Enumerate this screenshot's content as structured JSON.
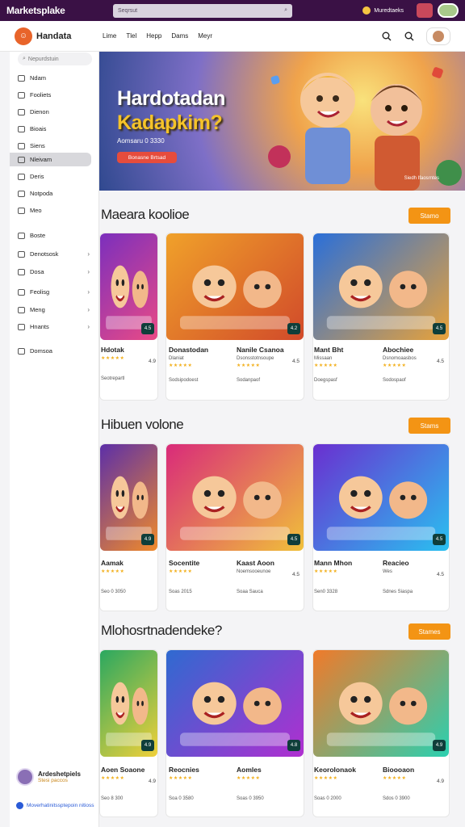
{
  "topbar": {
    "brand": "Marketsplake",
    "search_placeholder": "Seqrsut",
    "user_status": "Muredtaeks"
  },
  "header": {
    "logo_glyph": "☺",
    "app_name": "Handata",
    "nav": [
      "Lime",
      "Tlel",
      "Hepp",
      "Dams",
      "Meyr"
    ]
  },
  "sidebar": {
    "search_placeholder": "Nepurdstuin",
    "items": [
      {
        "label": "Ndam",
        "chevron": false,
        "active": false
      },
      {
        "label": "Fooliets",
        "chevron": false,
        "active": false
      },
      {
        "label": "Dienon",
        "chevron": false,
        "active": false
      },
      {
        "label": "Bioais",
        "chevron": false,
        "active": false
      },
      {
        "label": "Siens",
        "chevron": false,
        "active": false
      },
      {
        "label": "Nleivam",
        "chevron": false,
        "active": true
      },
      {
        "label": "Deris",
        "chevron": false,
        "active": false
      },
      {
        "label": "Notpoda",
        "chevron": false,
        "active": false
      },
      {
        "label": "Meo",
        "chevron": false,
        "active": false
      },
      {
        "label": "Boste",
        "chevron": false,
        "active": false
      },
      {
        "label": "Denotsosk",
        "chevron": true,
        "active": false
      },
      {
        "label": "Dosa",
        "chevron": true,
        "active": false
      },
      {
        "label": "Feolisg",
        "chevron": true,
        "active": false
      },
      {
        "label": "Meng",
        "chevron": true,
        "active": false
      },
      {
        "label": "Hnants",
        "chevron": true,
        "active": false
      },
      {
        "label": "Domsoa",
        "chevron": false,
        "active": false
      }
    ],
    "user_name": "Ardeshetpiels",
    "user_status": "Stesi paccos",
    "footer_link": "Moverhatinitssptepoin nitioss"
  },
  "hero": {
    "title_line1": "Hardotadan",
    "title_line2": "Kadapkim?",
    "meta": "Aomsaru 0 3330",
    "cta": "Bonasne Brtsad",
    "tag": "Siedh Ifaosrntes"
  },
  "sections": [
    {
      "title": "Maeara koolioe",
      "button": "Stamo",
      "cards": [
        {
          "title": "Hdotak",
          "sub1": "",
          "rating": "★★★★★",
          "score": "4.9",
          "footer": "Seotrepartl",
          "badge": "4.5"
        },
        {
          "title": "Donastodan",
          "sub1": "Dlaniat",
          "rating": "★★★★★",
          "score": "",
          "footer": "Sodsipodoest",
          "badge": ""
        },
        {
          "title": "Nanile Csanoa",
          "sub1": "Dsonsstotnsoupe",
          "rating": "★★★★★",
          "score": "4.5",
          "footer": "Sodanpaof",
          "badge": "4.2"
        },
        {
          "title": "Mant Bht",
          "sub1": "Missaan",
          "rating": "★★★★★",
          "score": "",
          "footer": "Doegspasf",
          "badge": ""
        },
        {
          "title": "Abochiee",
          "sub1": "Dsnomoaasbos",
          "rating": "★★★★★",
          "score": "4.5",
          "footer": "Sodospaof",
          "badge": "4.5"
        }
      ]
    },
    {
      "title": "Hibuen volone",
      "button": "Stams",
      "cards": [
        {
          "title": "Aamak",
          "sub1": "",
          "rating": "★★★★★",
          "score": "",
          "footer": "Seo 0 3050",
          "badge": "4.9"
        },
        {
          "title": "Socentite",
          "sub1": "",
          "rating": "★★★★★",
          "score": "",
          "footer": "Soas 2015",
          "badge": ""
        },
        {
          "title": "Kaast Aoon",
          "sub1": "Noemsooeunoe",
          "rating": "",
          "score": "4.5",
          "footer": "Soaa Sauca",
          "badge": "4.5"
        },
        {
          "title": "Mann Mhon",
          "sub1": "",
          "rating": "★★★★★",
          "score": "",
          "footer": "Sen0 3328",
          "badge": ""
        },
        {
          "title": "Reacieo",
          "sub1": "Wes",
          "rating": "",
          "score": "4.5",
          "footer": "Sdnes Siaspa",
          "badge": "4.5"
        }
      ]
    },
    {
      "title": "Mlohosrtnadendeke?",
      "button": "Stames",
      "cards": [
        {
          "title": "Aoen Soaone",
          "sub1": "",
          "rating": "★★★★★",
          "score": "4.9",
          "footer": "Seo 8 300",
          "badge": "4.9"
        },
        {
          "title": "Reocnies",
          "sub1": "",
          "rating": "★★★★★",
          "score": "",
          "footer": "Soa 0 3580",
          "badge": ""
        },
        {
          "title": "Aomles",
          "sub1": "",
          "rating": "★★★★★",
          "score": "",
          "footer": "Soas 0 3950",
          "badge": "4.8"
        },
        {
          "title": "Keorolonaok",
          "sub1": "",
          "rating": "★★★★★",
          "score": "",
          "footer": "Soas 0 2000",
          "badge": ""
        },
        {
          "title": "Bioooaon",
          "sub1": "",
          "rating": "★★★★★",
          "score": "4.9",
          "footer": "Sdos 0 3900",
          "badge": "4.9"
        }
      ]
    }
  ],
  "colors": {
    "topbar": "#3a1145",
    "accent": "#f39414",
    "star": "#f2b01e",
    "hero_cta": "#e64c3c"
  }
}
